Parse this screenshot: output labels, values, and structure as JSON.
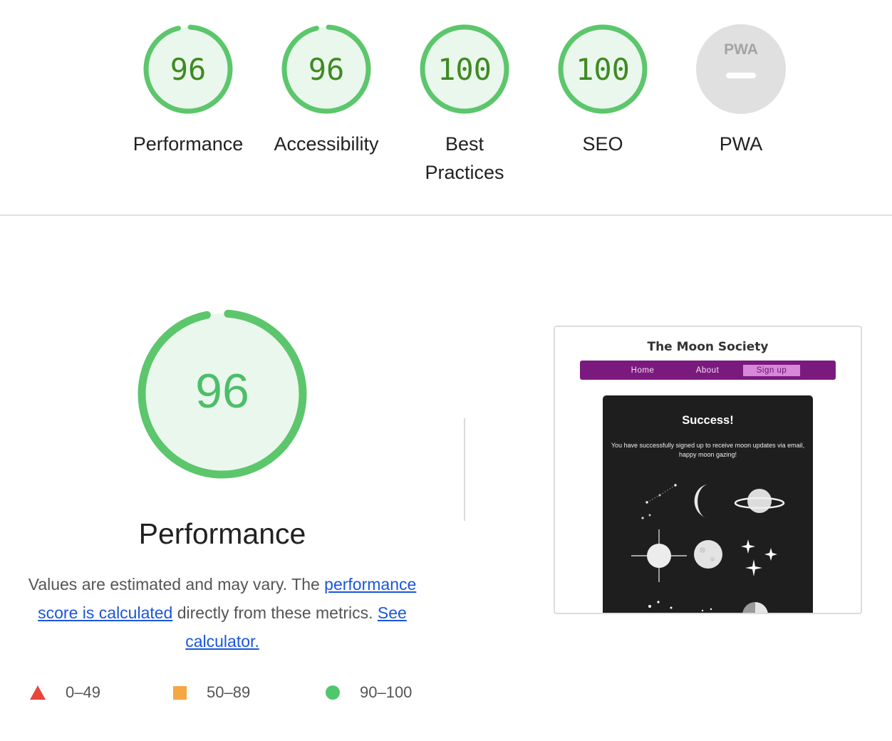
{
  "categories": [
    {
      "name": "performance",
      "score": "96",
      "label": "Performance",
      "fraction": 0.96
    },
    {
      "name": "accessibility",
      "score": "96",
      "label": "Accessibility",
      "fraction": 0.96
    },
    {
      "name": "best-practices",
      "score": "100",
      "label": "Best Practices",
      "fraction": 1.0
    },
    {
      "name": "seo",
      "score": "100",
      "label": "SEO",
      "fraction": 1.0
    },
    {
      "name": "pwa",
      "score": "",
      "label": "PWA",
      "badge": "PWA",
      "icon": "pwa-badge-icon"
    }
  ],
  "performance": {
    "score": "96",
    "fraction": 0.96,
    "title": "Performance",
    "desc_prefix": "Values are estimated and may vary. The ",
    "desc_link1": "performance score is calculated",
    "desc_middle": " directly from these metrics. ",
    "desc_link2": "See calculator."
  },
  "legend": [
    {
      "icon": "triangle",
      "range": "0–49",
      "color": "#e8453c"
    },
    {
      "icon": "square",
      "range": "50–89",
      "color": "#f4a742"
    },
    {
      "icon": "circle",
      "range": "90–100",
      "color": "#4fc76d"
    }
  ],
  "colors": {
    "pass": "#5cc66c",
    "pass_fill": "#eaf7ed",
    "pass_text": "#3f8a22",
    "pwa_gray": "#e0e0e0",
    "nav_purple": "#7b1a7e"
  },
  "screenshot": {
    "site_title": "The Moon Society",
    "nav": [
      "Home",
      "About",
      "Sign up"
    ],
    "active_nav": "Sign up",
    "card_title": "Success!",
    "card_message": "You have successfully signed up to receive moon updates via email, happy moon gazing!"
  }
}
